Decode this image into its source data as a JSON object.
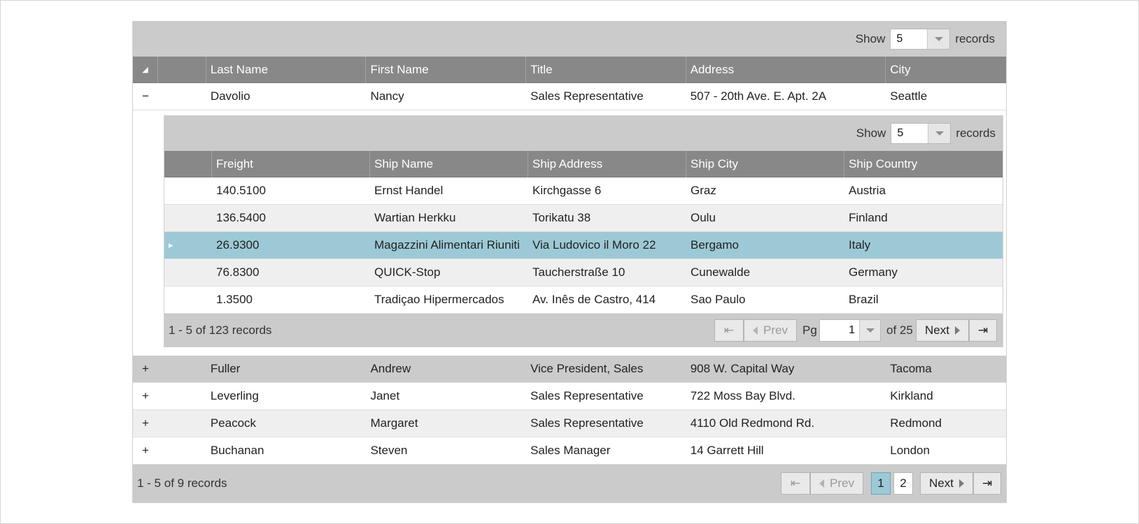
{
  "master": {
    "toolbar": {
      "show_label": "Show",
      "page_size": "5",
      "records_label": "records"
    },
    "columns": [
      "Last Name",
      "First Name",
      "Title",
      "Address",
      "City"
    ],
    "rows": [
      {
        "expander": "−",
        "last": "Davolio",
        "first": "Nancy",
        "title": "Sales Representative",
        "address": "507 - 20th Ave. E. Apt. 2A",
        "city": "Seattle"
      },
      {
        "expander": "+",
        "last": "Fuller",
        "first": "Andrew",
        "title": "Vice President, Sales",
        "address": "908 W. Capital Way",
        "city": "Tacoma"
      },
      {
        "expander": "+",
        "last": "Leverling",
        "first": "Janet",
        "title": "Sales Representative",
        "address": "722 Moss Bay Blvd.",
        "city": "Kirkland"
      },
      {
        "expander": "+",
        "last": "Peacock",
        "first": "Margaret",
        "title": "Sales Representative",
        "address": "4110 Old Redmond Rd.",
        "city": "Redmond"
      },
      {
        "expander": "+",
        "last": "Buchanan",
        "first": "Steven",
        "title": "Sales Manager",
        "address": "14 Garrett Hill",
        "city": "London"
      }
    ],
    "pager": {
      "info": "1 - 5 of 9 records",
      "prev": "Prev",
      "next": "Next",
      "pages": [
        "1",
        "2"
      ],
      "current_page": "1"
    }
  },
  "detail": {
    "toolbar": {
      "show_label": "Show",
      "page_size": "5",
      "records_label": "records"
    },
    "columns": [
      "Freight",
      "Ship Name",
      "Ship Address",
      "Ship City",
      "Ship Country"
    ],
    "rows": [
      {
        "freight": "140.5100",
        "ship_name": "Ernst Handel",
        "ship_address": "Kirchgasse 6",
        "ship_city": "Graz",
        "ship_country": "Austria"
      },
      {
        "freight": "136.5400",
        "ship_name": "Wartian Herkku",
        "ship_address": "Torikatu 38",
        "ship_city": "Oulu",
        "ship_country": "Finland"
      },
      {
        "freight": "26.9300",
        "ship_name": "Magazzini Alimentari Riuniti",
        "ship_address": "Via Ludovico il Moro 22",
        "ship_city": "Bergamo",
        "ship_country": "Italy"
      },
      {
        "freight": "76.8300",
        "ship_name": "QUICK-Stop",
        "ship_address": "Taucherstraße 10",
        "ship_city": "Cunewalde",
        "ship_country": "Germany"
      },
      {
        "freight": "1.3500",
        "ship_name": "Tradiçao Hipermercados",
        "ship_address": "Av. Inês de Castro, 414",
        "ship_city": "Sao Paulo",
        "ship_country": "Brazil"
      }
    ],
    "pager": {
      "info": "1 - 5 of 123 records",
      "prev": "Prev",
      "next": "Next",
      "pg_label": "Pg",
      "page_value": "1",
      "of_label": "of 25"
    }
  },
  "icons": {
    "first": "⇤",
    "last": "⇥",
    "collapse_all": "◢",
    "row_indicator": "▸"
  },
  "colors": {
    "header": "#888888",
    "toolbar": "#cbcbcb",
    "selected": "#9dc9d6",
    "alt_row": "#efefef"
  }
}
